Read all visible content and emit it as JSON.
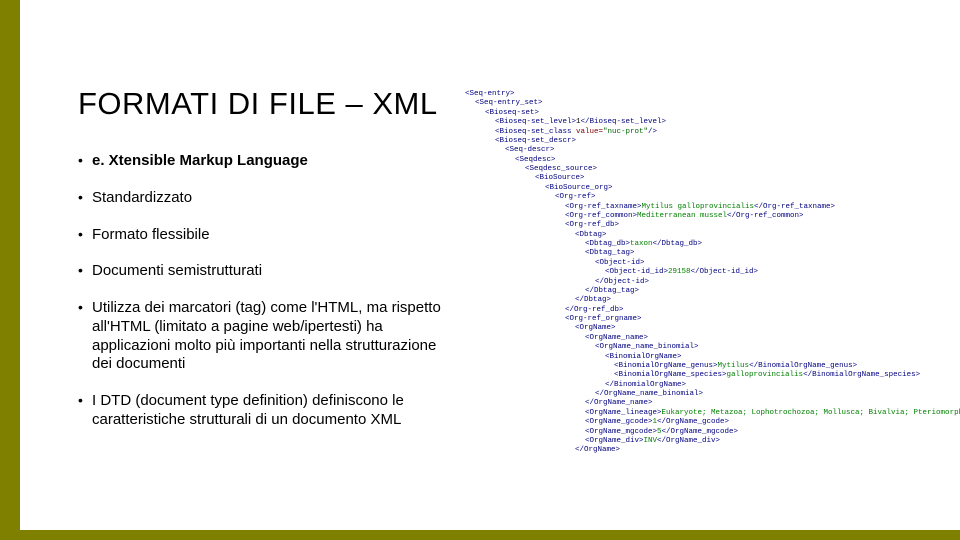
{
  "title": "FORMATI DI FILE – XML",
  "bullets": [
    "e. Xtensible Markup Language",
    "Standardizzato",
    "Formato flessibile",
    "Documenti semistrutturati",
    "Utilizza dei marcatori (tag) come l'HTML, ma rispetto all'HTML (limitato a pagine web/ipertesti) ha applicazioni molto più importanti nella strutturazione dei documenti",
    "I DTD (document type definition) definiscono le caratteristiche strutturali di un documento XML"
  ],
  "xml_lines": [
    {
      "i": 0,
      "h": "<span class='t'>&lt;Seq-entry&gt;</span>"
    },
    {
      "i": 1,
      "h": "<span class='t'>&lt;Seq-entry_set&gt;</span>"
    },
    {
      "i": 2,
      "h": "<span class='t'>&lt;Bioseq-set&gt;</span>"
    },
    {
      "i": 3,
      "h": "<span class='t'>&lt;Bioseq-set_level&gt;</span><span class='x'>1</span><span class='t'>&lt;/Bioseq-set_level&gt;</span>"
    },
    {
      "i": 3,
      "h": "<span class='t'>&lt;Bioseq-set_class </span><span class='a'>value=</span><span class='v'>\"nuc-prot\"</span><span class='t'>/&gt;</span>"
    },
    {
      "i": 3,
      "h": "<span class='t'>&lt;Bioseq-set_descr&gt;</span>"
    },
    {
      "i": 4,
      "h": "<span class='t'>&lt;Seq-descr&gt;</span>"
    },
    {
      "i": 5,
      "h": "<span class='t'>&lt;Seqdesc&gt;</span>"
    },
    {
      "i": 6,
      "h": "<span class='t'>&lt;Seqdesc_source&gt;</span>"
    },
    {
      "i": 7,
      "h": "<span class='t'>&lt;BioSource&gt;</span>"
    },
    {
      "i": 8,
      "h": "<span class='t'>&lt;BioSource_org&gt;</span>"
    },
    {
      "i": 9,
      "h": "<span class='t'>&lt;Org-ref&gt;</span>"
    },
    {
      "i": 10,
      "h": "<span class='t'>&lt;Org-ref_taxname&gt;</span><span class='g'>Mytilus galloprovincialis</span><span class='t'>&lt;/Org-ref_taxname&gt;</span>"
    },
    {
      "i": 10,
      "h": "<span class='t'>&lt;Org-ref_common&gt;</span><span class='g'>Mediterranean mussel</span><span class='t'>&lt;/Org-ref_common&gt;</span>"
    },
    {
      "i": 10,
      "h": "<span class='t'>&lt;Org-ref_db&gt;</span>"
    },
    {
      "i": 11,
      "h": "<span class='t'>&lt;Dbtag&gt;</span>"
    },
    {
      "i": 12,
      "h": "<span class='t'>&lt;Dbtag_db&gt;</span><span class='g'>taxon</span><span class='t'>&lt;/Dbtag_db&gt;</span>"
    },
    {
      "i": 12,
      "h": "<span class='t'>&lt;Dbtag_tag&gt;</span>"
    },
    {
      "i": 13,
      "h": "<span class='t'>&lt;Object-id&gt;</span>"
    },
    {
      "i": 14,
      "h": "<span class='t'>&lt;Object-id_id&gt;</span><span class='g'>29158</span><span class='t'>&lt;/Object-id_id&gt;</span>"
    },
    {
      "i": 13,
      "h": "<span class='t'>&lt;/Object-id&gt;</span>"
    },
    {
      "i": 12,
      "h": "<span class='t'>&lt;/Dbtag_tag&gt;</span>"
    },
    {
      "i": 11,
      "h": "<span class='t'>&lt;/Dbtag&gt;</span>"
    },
    {
      "i": 10,
      "h": "<span class='t'>&lt;/Org-ref_db&gt;</span>"
    },
    {
      "i": 10,
      "h": "<span class='t'>&lt;Org-ref_orgname&gt;</span>"
    },
    {
      "i": 11,
      "h": "<span class='t'>&lt;OrgName&gt;</span>"
    },
    {
      "i": 12,
      "h": "<span class='t'>&lt;OrgName_name&gt;</span>"
    },
    {
      "i": 13,
      "h": "<span class='t'>&lt;OrgName_name_binomial&gt;</span>"
    },
    {
      "i": 14,
      "h": "<span class='t'>&lt;BinomialOrgName&gt;</span>"
    },
    {
      "i": 14,
      "h": "  <span class='t'>&lt;BinomialOrgName_genus&gt;</span><span class='g'>Mytilus</span><span class='t'>&lt;/BinomialOrgName_genus&gt;</span>"
    },
    {
      "i": 14,
      "h": "  <span class='t'>&lt;BinomialOrgName_species&gt;</span><span class='g'>galloprovincialis</span><span class='t'>&lt;/BinomialOrgName_species&gt;</span>"
    },
    {
      "i": 14,
      "h": "<span class='t'>&lt;/BinomialOrgName&gt;</span>"
    },
    {
      "i": 13,
      "h": "<span class='t'>&lt;/OrgName_name_binomial&gt;</span>"
    },
    {
      "i": 12,
      "h": "<span class='t'>&lt;/OrgName_name&gt;</span>"
    },
    {
      "i": 12,
      "h": "<span class='t'>&lt;OrgName_lineage&gt;</span><span class='g'>Eukaryote; Metazoa; Lophotrochozoa; Mollusca; Bivalvia; Pteriomorphia;</span>"
    },
    {
      "i": 12,
      "h": "<span class='t'>&lt;OrgName_gcode&gt;</span><span class='g'>1</span><span class='t'>&lt;/OrgName_gcode&gt;</span>"
    },
    {
      "i": 12,
      "h": "<span class='t'>&lt;OrgName_mgcode&gt;</span><span class='g'>5</span><span class='t'>&lt;/OrgName_mgcode&gt;</span>"
    },
    {
      "i": 12,
      "h": "<span class='t'>&lt;OrgName_div&gt;</span><span class='g'>INV</span><span class='t'>&lt;/OrgName_div&gt;</span>"
    },
    {
      "i": 11,
      "h": "<span class='t'>&lt;/OrgName&gt;</span>"
    }
  ]
}
